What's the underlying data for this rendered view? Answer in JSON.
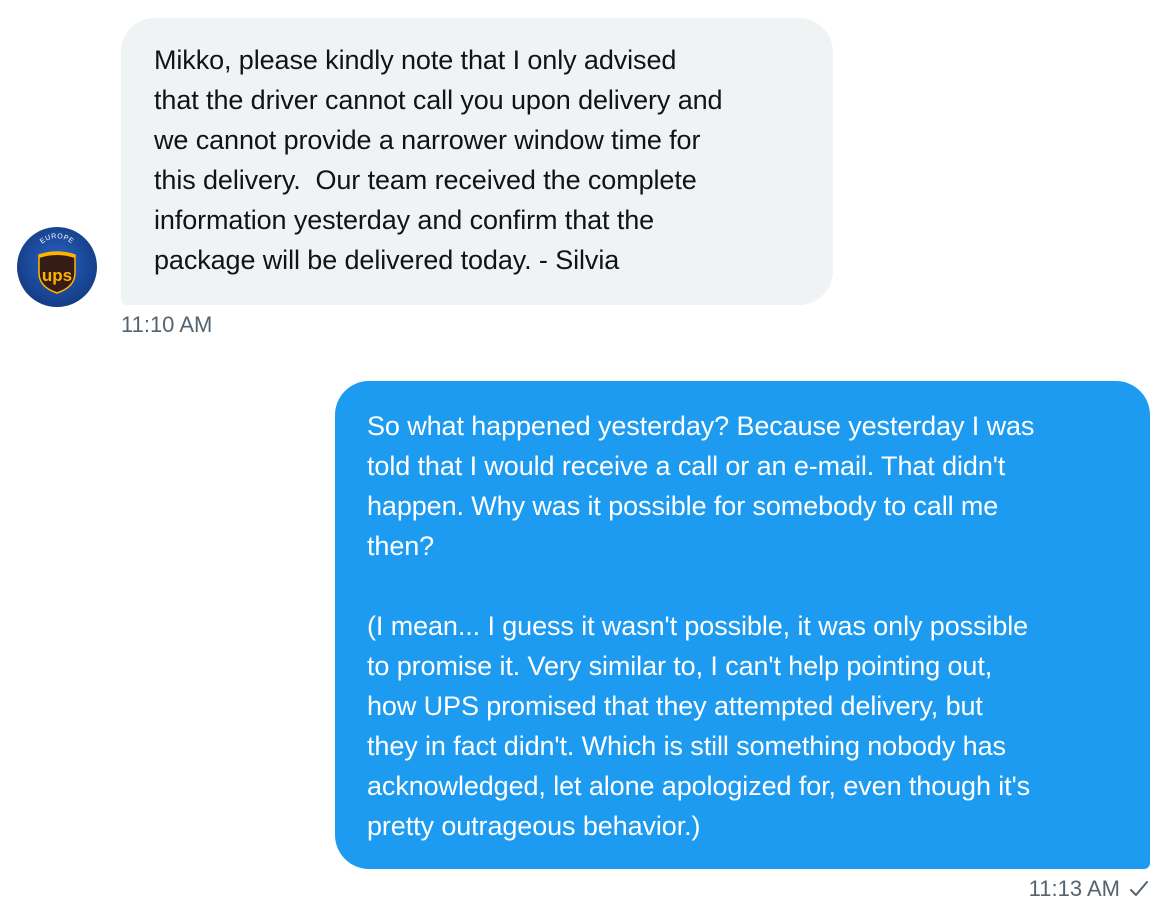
{
  "thread": {
    "messages": [
      {
        "direction": "incoming",
        "sender_avatar": {
          "icon": "ups-europe-logo",
          "label": "EUROPE",
          "logo_text": "ups",
          "colors": {
            "background": "#1a4da1",
            "shield": "#351c15",
            "gold": "#ffb500"
          }
        },
        "text": "Mikko, please kindly note that I only advised\nthat the driver cannot call you upon delivery and\nwe cannot provide a narrower window time for\nthis delivery.  Our team received the complete\ninformation yesterday and confirm that the\npackage will be delivered today. - Silvia",
        "time": "11:10 AM"
      },
      {
        "direction": "outgoing",
        "text": "So what happened yesterday? Because yesterday I was\ntold that I would receive a call or an e-mail. That didn't\nhappen. Why was it possible for somebody to call me\nthen?\n\n(I mean... I guess it wasn't possible, it was only possible\nto promise it. Very similar to, I can't help pointing out,\nhow UPS promised that they attempted delivery, but\nthey in fact didn't. Which is still something nobody has\nacknowledged, let alone apologized for, even though it's\npretty outrageous behavior.)",
        "time": "11:13 AM",
        "status_icon": "sent-check-icon"
      }
    ]
  },
  "colors": {
    "incoming_bubble": "#eff3f4",
    "outgoing_bubble": "#1d9bf0",
    "timestamp": "#536471",
    "text_dark": "#0f1419"
  }
}
